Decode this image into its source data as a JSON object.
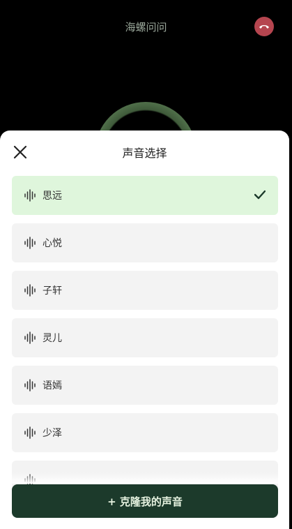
{
  "call": {
    "title": "海螺问问"
  },
  "sheet": {
    "title": "声音选择",
    "voices": [
      {
        "name": "思远",
        "selected": true
      },
      {
        "name": "心悦",
        "selected": false
      },
      {
        "name": "子轩",
        "selected": false
      },
      {
        "name": "灵儿",
        "selected": false
      },
      {
        "name": "语嫣",
        "selected": false
      },
      {
        "name": "少泽",
        "selected": false
      },
      {
        "name": "",
        "selected": false
      }
    ],
    "clone_button": "+ 克隆我的声音"
  },
  "colors": {
    "selected_bg": "#dff6dc",
    "primary_button": "#1c3a2b",
    "hangup": "#b5454f"
  }
}
